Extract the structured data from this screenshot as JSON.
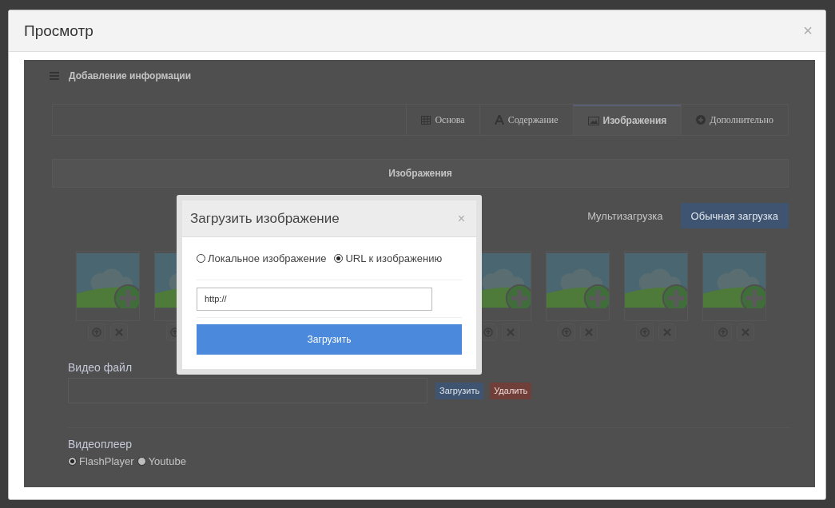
{
  "window": {
    "title": "Просмотр",
    "close": "×"
  },
  "preview": {
    "panel_title": "Добавление информации",
    "tabs": [
      {
        "label": "Основа",
        "selected": false
      },
      {
        "label": "Содержание",
        "selected": false
      },
      {
        "label": "Изображения",
        "selected": true
      },
      {
        "label": "Дополнительно",
        "selected": false
      }
    ],
    "section_title": "Изображения",
    "upload_modes": [
      {
        "label": "Мультизагрузка",
        "selected": false
      },
      {
        "label": "Обычная загрузка",
        "selected": true
      }
    ],
    "image_slots": [
      {
        "kind": "placeholder"
      },
      {
        "kind": "placeholder"
      },
      {
        "kind": "placeholder"
      },
      {
        "kind": "placeholder"
      },
      {
        "kind": "placeholder"
      },
      {
        "kind": "placeholder"
      }
    ],
    "video": {
      "label": "Видео файл",
      "buttons": [
        {
          "label": "Загрузить",
          "kind": "primary"
        },
        {
          "label": "Удалить",
          "kind": "danger"
        }
      ]
    },
    "player": {
      "label": "Видеоплеер",
      "options": [
        {
          "label": "FlashPlayer",
          "selected": true
        },
        {
          "label": "Youtube",
          "selected": false
        }
      ]
    },
    "dialog": {
      "title": "Загрузить изображение",
      "close": "×",
      "sources": [
        {
          "label": "Локальное изображение",
          "selected": false
        },
        {
          "label": "URL к изображению",
          "selected": true
        }
      ],
      "url": "http://",
      "submit": "Загрузить"
    }
  }
}
